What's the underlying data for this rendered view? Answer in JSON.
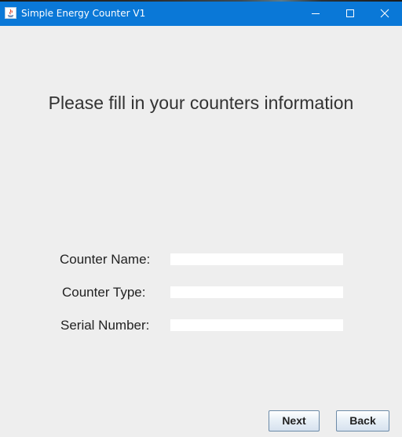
{
  "window": {
    "title": "Simple Energy Counter V1",
    "controls": {
      "minimize": "minimize-icon",
      "maximize": "maximize-icon",
      "close": "close-icon"
    },
    "titlebar_color": "#0a78d7"
  },
  "form": {
    "heading": "Please fill in your counters information",
    "fields": [
      {
        "label": "Counter Name:",
        "value": ""
      },
      {
        "label": "Counter Type:",
        "value": ""
      },
      {
        "label": "Serial Number:",
        "value": ""
      }
    ]
  },
  "buttons": {
    "next_label": "Next",
    "back_label": "Back"
  }
}
